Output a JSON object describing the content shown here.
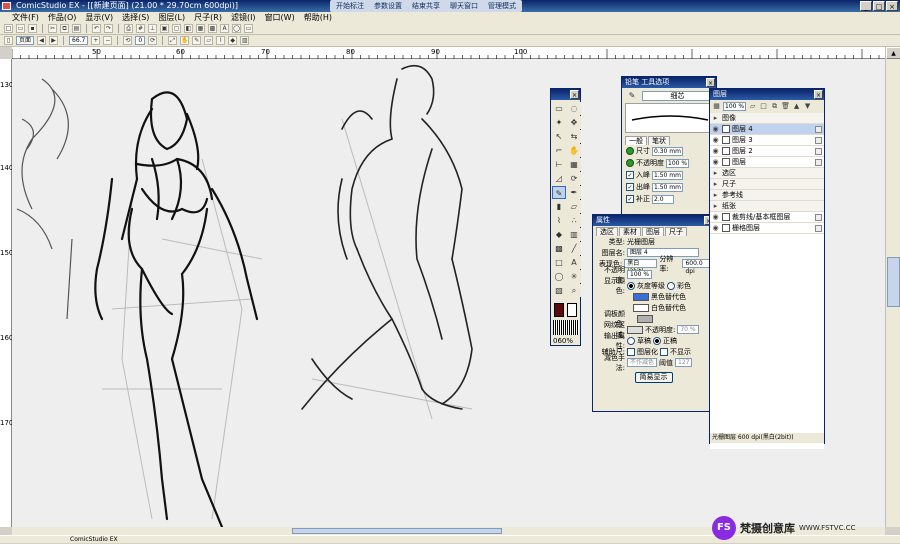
{
  "window": {
    "title": "ComicStudio EX - [[新建页面] (21.00 * 29.70cm 600dpi)]"
  },
  "qq_bar": [
    "开始标注",
    "参数设置",
    "结束共享",
    "聊天窗口",
    "管理模式"
  ],
  "menu": [
    "文件(F)",
    "作品(O)",
    "显示(V)",
    "选择(S)",
    "图层(L)",
    "尺子(R)",
    "滤镜(I)",
    "窗口(W)",
    "帮助(H)"
  ],
  "toolbar": {
    "page_tab": "页面",
    "zoom_value": "66.7",
    "rotate_value": "0"
  },
  "ruler": {
    "top_labels": [
      "50",
      "60",
      "70",
      "80",
      "90",
      "100"
    ],
    "left_labels": [
      "130",
      "140",
      "150",
      "160",
      "170"
    ]
  },
  "toolbox": {
    "zoom_label": "060%"
  },
  "pen_options": {
    "title": "铅笔 工具选项",
    "nib": "细芯",
    "tabs": [
      "一般",
      "笔状"
    ],
    "size_label": "尺寸",
    "size_value": "0.30 mm",
    "opacity_label": "不透明度",
    "opacity_value": "100 %",
    "in_label": "入峰",
    "in_value": "1.50 mm",
    "out_label": "出峰",
    "out_value": "1.50 mm",
    "correct_label": "补正",
    "correct_value": "2.0"
  },
  "properties": {
    "title": "属性",
    "tabs": [
      "选区",
      "素材",
      "图层",
      "尺子"
    ],
    "type_label": "类型:",
    "type_value": "光栅图层",
    "name_label": "图层名:",
    "name_value": "图层 4",
    "expr_label": "表现色:",
    "expr_value": "黑白 (2bit)",
    "res_label": "分辨率:",
    "res_value": "600.0 dpi",
    "opacity_label": "不透明度:",
    "opacity_value": "100 %",
    "display_label": "显示颜色:",
    "gray_option": "灰度等级",
    "color_option": "彩色",
    "black_label": "黑色替代色",
    "white_label": "白色替代色",
    "palette_label": "调板颜色:",
    "mesh_label": "网纹区域:",
    "mesh_opacity_label": "不透明度:",
    "mesh_opacity_value": "70 %",
    "output_label": "输出属性:",
    "draft_option": "草稿",
    "final_option": "正稿",
    "aux_label": "辅助尺:",
    "rasterize_option": "图层化",
    "hide_option": "不显示",
    "reduce_label": "减色手法:",
    "reduce_value": "不作减色",
    "threshold_label": "阈值",
    "threshold_value": "127",
    "simple_button": "简易显示"
  },
  "layers": {
    "title": "图层",
    "opacity": "100 %",
    "rows": [
      {
        "name": "图像",
        "kind": "group"
      },
      {
        "name": "图层 4",
        "kind": "selected"
      },
      {
        "name": "图层 3",
        "kind": "layer"
      },
      {
        "name": "图层 2",
        "kind": "layer"
      },
      {
        "name": "图层",
        "kind": "layer"
      },
      {
        "name": "选区",
        "kind": "group"
      },
      {
        "name": "尺子",
        "kind": "group"
      },
      {
        "name": "参考线",
        "kind": "group"
      },
      {
        "name": "纸张",
        "kind": "group"
      },
      {
        "name": "裁剪线/基本框图层",
        "kind": "layer"
      },
      {
        "name": "栅格图层",
        "kind": "layer"
      }
    ],
    "status": "光栅图层 600 dpi(黑白(2bit))"
  },
  "status_bar": {
    "text": "ComicStudio EX"
  },
  "watermark": {
    "logo": "FS",
    "name": "梵摄创意库",
    "url": "WWW.FSTVC.CC"
  },
  "colors": {
    "title_bar": "#0a246a",
    "canvas": "#eeeeee",
    "selected_layer": "#c1d2ee"
  }
}
